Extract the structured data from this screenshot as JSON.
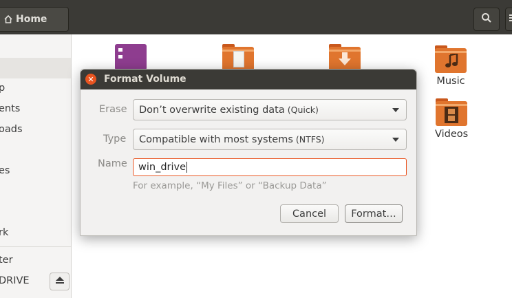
{
  "header": {
    "home_label": "Home"
  },
  "sidebar": {
    "items": [
      {
        "label": "p"
      },
      {
        "label": "ents"
      },
      {
        "label": "oads"
      },
      {
        "label": "es"
      },
      {
        "label": "rk"
      },
      {
        "label": "ter"
      },
      {
        "label": "DRIVE"
      }
    ]
  },
  "content": {
    "files": [
      {
        "label": "Music",
        "icon": "music-folder-icon"
      },
      {
        "label": "Videos",
        "icon": "videos-folder-icon"
      }
    ]
  },
  "dialog": {
    "title": "Format Volume",
    "erase": {
      "label": "Erase",
      "value": "Don’t overwrite existing data",
      "value_suffix": "(Quick)"
    },
    "type": {
      "label": "Type",
      "value": "Compatible with most systems",
      "value_suffix": "(NTFS)"
    },
    "name": {
      "label": "Name",
      "value": "win_drive",
      "hint": "For example, “My Files” or “Backup Data”"
    },
    "buttons": {
      "cancel": "Cancel",
      "format": "Format…"
    }
  },
  "colors": {
    "accent": "#e95420",
    "headerbar": "#3b3a36",
    "folder": "#e0752e"
  }
}
